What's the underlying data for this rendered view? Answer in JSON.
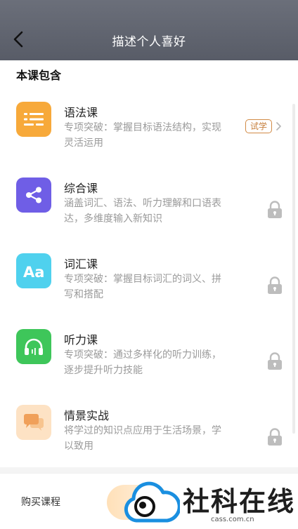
{
  "header": {
    "title": "描述个人喜好"
  },
  "section": {
    "title": "本课包含"
  },
  "courses": [
    {
      "name": "语法课",
      "desc": "专项突破：掌握目标语法结构，实现灵活运用",
      "status": "试学",
      "icon": "list-icon",
      "color": "#f7a93a"
    },
    {
      "name": "综合课",
      "desc": "涵盖词汇、语法、听力理解和口语表达，多维度输入新知识",
      "status": "locked",
      "icon": "share-icon",
      "color": "#6f5ee6"
    },
    {
      "name": "词汇课",
      "desc": "专项突破：掌握目标词汇的词义、拼写和搭配",
      "status": "locked",
      "icon": "letters-icon",
      "color": "#4fd1ee"
    },
    {
      "name": "听力课",
      "desc": "专项突破：通过多样化的听力训练，逐步提升听力技能",
      "status": "locked",
      "icon": "headphones-icon",
      "color": "#3ec65a"
    },
    {
      "name": "情景实战",
      "desc": "将学过的知识点应用于生活场景，学以致用",
      "status": "locked",
      "icon": "chat-icon",
      "color": "#fde2c4"
    }
  ],
  "footer": {
    "buy_label": "购买课程"
  },
  "watermark": {
    "text": "社科在线",
    "url": "cass.com.cn"
  }
}
